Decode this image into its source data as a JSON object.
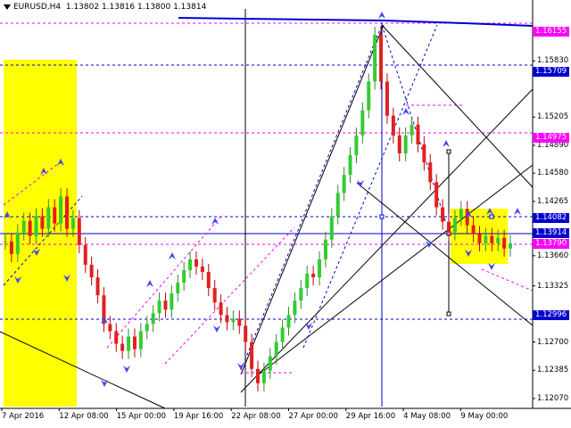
{
  "header": {
    "symbol_timeframe": "EURUSD,H4",
    "quote": "1.13802 1.13816 1.13800 1.13814"
  },
  "chart_data": {
    "type": "candlestick",
    "symbol": "EURUSD",
    "timeframe": "H4",
    "ylim": [
      1.1202,
      1.1625
    ],
    "y_ticks": [
      "1.15830",
      "1.15205",
      "1.14890",
      "1.14580",
      "1.14265",
      "1.13660",
      "1.13325",
      "1.12700",
      "1.12385",
      "1.12070"
    ],
    "x_ticks": [
      "7 Apr 2016",
      "12 Apr 08:00",
      "15 Apr 00:00",
      "19 Apr 16:00",
      "22 Apr 08:00",
      "27 Apr 00:00",
      "29 Apr 16:00",
      "4 May 08:00",
      "9 May 00:00"
    ],
    "price_tags": [
      {
        "label": "1.16155",
        "value": 1.16155,
        "color": "#ff00ff"
      },
      {
        "label": "1.15709",
        "value": 1.15709,
        "color": "#0000cc"
      },
      {
        "label": "1.14975",
        "value": 1.14975,
        "color": "#ff00ff"
      },
      {
        "label": "1.14082",
        "value": 1.14082,
        "color": "#0000cc"
      },
      {
        "label": "1.13914",
        "value": 1.13914,
        "color": "#0000cc"
      },
      {
        "label": "1.13790",
        "value": 1.1379,
        "color": "#ff00ff"
      },
      {
        "label": "1.12996",
        "value": 1.12996,
        "color": "#0000cc"
      }
    ],
    "series": [
      {
        "values": [
          1.1382,
          1.1368,
          1.1392,
          1.1405,
          1.1388,
          1.141,
          1.1396,
          1.142,
          1.1402,
          1.1432,
          1.1396,
          1.1408,
          1.1378,
          1.1356,
          1.1342,
          1.1322,
          1.129,
          1.1282,
          1.1268,
          1.126,
          1.1276,
          1.1262,
          1.1282,
          1.129,
          1.1302,
          1.1316,
          1.1306,
          1.1324,
          1.1336,
          1.135,
          1.1362,
          1.1354,
          1.1348,
          1.133,
          1.1314,
          1.13,
          1.1292,
          1.1296,
          1.1288,
          1.127,
          1.124,
          1.1224,
          1.1238,
          1.1254,
          1.127,
          1.1286,
          1.13,
          1.1316,
          1.133,
          1.1346,
          1.1342,
          1.1362,
          1.1384,
          1.141,
          1.1436,
          1.1456,
          1.1478,
          1.15,
          1.1528,
          1.156,
          1.1612,
          1.156,
          1.1522,
          1.15,
          1.148,
          1.15,
          1.1512,
          1.149,
          1.147,
          1.1448,
          1.142,
          1.1404,
          1.1392,
          1.1408,
          1.1418,
          1.14,
          1.139,
          1.138,
          1.1388,
          1.138,
          1.1386,
          1.1374,
          1.138
        ]
      }
    ]
  }
}
